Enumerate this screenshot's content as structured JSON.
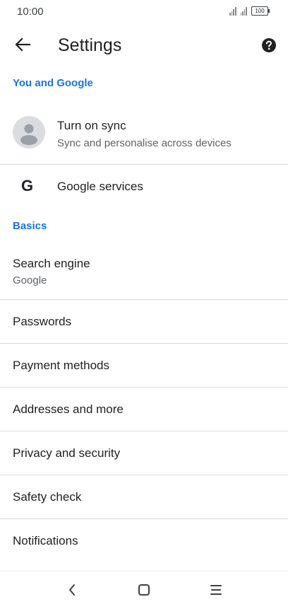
{
  "status": {
    "time": "10:00",
    "battery": "100"
  },
  "toolbar": {
    "title": "Settings"
  },
  "sections": {
    "you_and_google": "You and Google",
    "basics": "Basics"
  },
  "sync": {
    "title": "Turn on sync",
    "subtitle": "Sync and personalise across devices"
  },
  "google_services": {
    "icon_letter": "G",
    "label": "Google services"
  },
  "search_engine": {
    "title": "Search engine",
    "value": "Google"
  },
  "items": [
    "Passwords",
    "Payment methods",
    "Addresses and more",
    "Privacy and security",
    "Safety check",
    "Notifications"
  ],
  "colors": {
    "accent": "#1a73e8",
    "divider": "#dadce0",
    "secondary_text": "#5f6368"
  },
  "icons": {
    "back": "arrow-left-icon",
    "help": "help-icon",
    "avatar": "account-avatar-icon",
    "nav_back": "chevron-left-icon",
    "nav_home": "square-home-icon",
    "nav_menu": "menu-icon"
  }
}
